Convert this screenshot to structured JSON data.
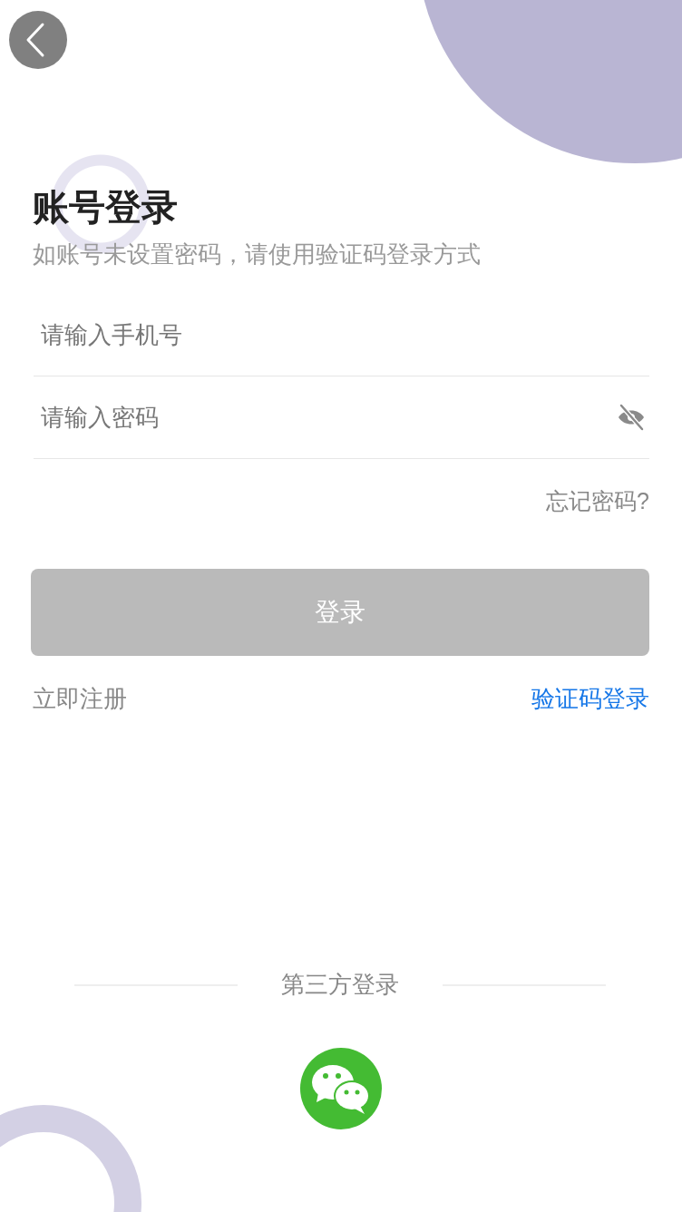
{
  "title": "账号登录",
  "subtitle": "如账号未设置密码，请使用验证码登录方式",
  "phone_field": {
    "placeholder": "请输入手机号"
  },
  "password_field": {
    "placeholder": "请输入密码",
    "password_visible": false
  },
  "forgot_password": "忘记密码?",
  "login_button": {
    "label": "登录",
    "disabled": true
  },
  "register_link": "立即注册",
  "code_login_link": "验证码登录",
  "third_party": {
    "label": "第三方登录"
  }
}
